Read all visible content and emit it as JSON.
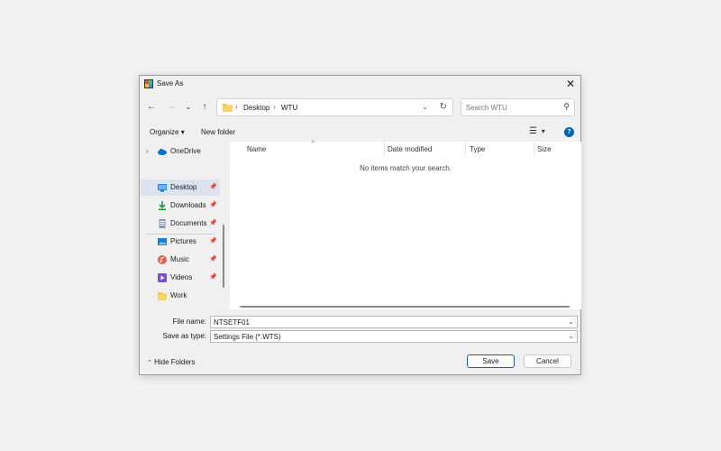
{
  "dialog": {
    "title": "Save As"
  },
  "nav": {
    "back_icon": "arrow-left-icon",
    "forward_icon": "arrow-right-icon",
    "recent_icon": "chevron-down-icon",
    "up_icon": "arrow-up-icon"
  },
  "address": {
    "crumbs": [
      "Desktop",
      "WTU"
    ]
  },
  "search": {
    "placeholder": "Search WTU"
  },
  "toolbar": {
    "organize_label": "Organize",
    "new_folder_label": "New folder"
  },
  "sidebar": {
    "items": [
      {
        "label": "OneDrive",
        "icon": "cloud-icon",
        "pinned": false,
        "selected": false
      },
      {
        "label": "Desktop",
        "icon": "desktop-icon",
        "pinned": true,
        "selected": true
      },
      {
        "label": "Downloads",
        "icon": "download-icon",
        "pinned": true,
        "selected": false
      },
      {
        "label": "Documents",
        "icon": "document-icon",
        "pinned": true,
        "selected": false
      },
      {
        "label": "Pictures",
        "icon": "picture-icon",
        "pinned": true,
        "selected": false
      },
      {
        "label": "Music",
        "icon": "music-icon",
        "pinned": true,
        "selected": false
      },
      {
        "label": "Videos",
        "icon": "video-icon",
        "pinned": true,
        "selected": false
      },
      {
        "label": "Work",
        "icon": "folder-icon",
        "pinned": false,
        "selected": false
      }
    ]
  },
  "list": {
    "columns": [
      "Name",
      "Date modified",
      "Type",
      "Size"
    ],
    "empty_message": "No items match your search."
  },
  "form": {
    "file_name_label": "File name:",
    "file_name_value": "NTSETF01",
    "type_label": "Save as type:",
    "type_value": "Settings File (*.WTS)"
  },
  "footer": {
    "hide_folders_label": "Hide Folders",
    "save_label": "Save",
    "cancel_label": "Cancel"
  },
  "colors": {
    "accent": "#0067c0",
    "selected_bg": "#dde3ee",
    "folder": "#f5c343"
  }
}
